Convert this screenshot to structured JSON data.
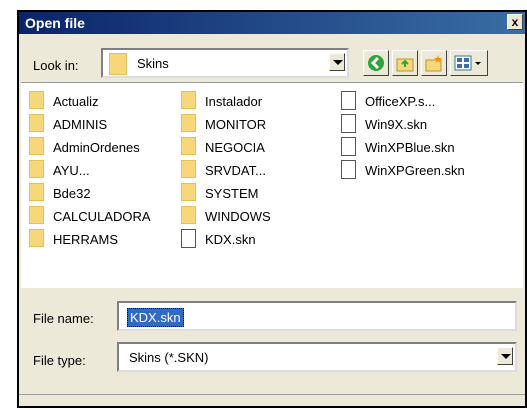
{
  "dialog": {
    "title": "Open file",
    "close_glyph": "x"
  },
  "lookin": {
    "label": "Look in:",
    "value": "Skins",
    "icon": "folder-icon"
  },
  "toolbar": {
    "buttons": [
      {
        "name": "back-button",
        "icon": "back-arrow-icon",
        "color": "#2fa43a"
      },
      {
        "name": "up-folder-button",
        "icon": "up-folder-icon",
        "color": "#f6d87a"
      },
      {
        "name": "new-folder-button",
        "icon": "new-folder-icon",
        "color": "#f6d87a"
      },
      {
        "name": "views-menu-button",
        "icon": "view-menu-icon",
        "color": "#3a6ea5"
      }
    ]
  },
  "files": {
    "col1": [
      {
        "name": "Actualiz",
        "type": "folder"
      },
      {
        "name": "ADMINIS",
        "type": "folder"
      },
      {
        "name": "AdminOrdenes",
        "type": "folder"
      },
      {
        "name": "AYU...",
        "type": "folder"
      },
      {
        "name": "Bde32",
        "type": "folder"
      },
      {
        "name": "CALCULADORA",
        "type": "folder"
      },
      {
        "name": "HERRAMS",
        "type": "folder"
      }
    ],
    "col2": [
      {
        "name": "Instalador",
        "type": "folder"
      },
      {
        "name": "MONITOR",
        "type": "folder"
      },
      {
        "name": "NEGOCIA",
        "type": "folder"
      },
      {
        "name": "SRVDAT...",
        "type": "folder"
      },
      {
        "name": "SYSTEM",
        "type": "folder"
      },
      {
        "name": "WINDOWS",
        "type": "folder"
      },
      {
        "name": "KDX.skn",
        "type": "file"
      }
    ],
    "col3": [
      {
        "name": "OfficeXP.s...",
        "type": "file"
      },
      {
        "name": "Win9X.skn",
        "type": "file"
      },
      {
        "name": "WinXPBlue.skn",
        "type": "file"
      },
      {
        "name": "WinXPGreen.skn",
        "type": "file"
      }
    ]
  },
  "filename": {
    "label": "File name:",
    "value": "KDX.skn"
  },
  "filetype": {
    "label": "File type:",
    "value": "Skins (*.SKN)"
  },
  "colors": {
    "title_bar": "#0a246a",
    "dialog_bg": "#ece9d8",
    "selection": "#316ac5",
    "folder": "#f6d87a"
  }
}
